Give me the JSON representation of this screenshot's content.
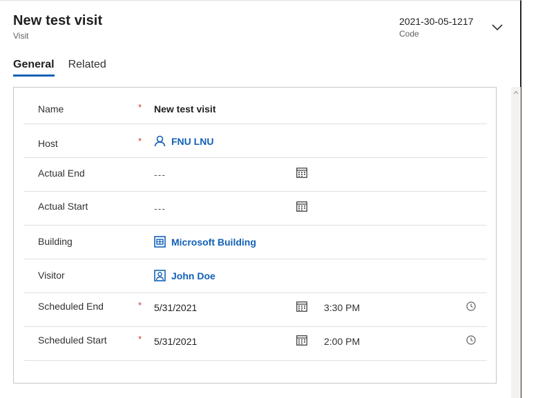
{
  "header": {
    "title": "New test visit",
    "entity": "Visit",
    "code_value": "2021-30-05-1217",
    "code_label": "Code"
  },
  "tabs": [
    {
      "label": "General",
      "active": true
    },
    {
      "label": "Related",
      "active": false
    }
  ],
  "fields": {
    "name": {
      "label": "Name",
      "required": "*",
      "value": "New test visit"
    },
    "host": {
      "label": "Host",
      "required": "*",
      "value": "FNU LNU",
      "icon": "person-icon"
    },
    "actual_end": {
      "label": "Actual End",
      "value": "---",
      "icon": "calendar-icon"
    },
    "actual_start": {
      "label": "Actual Start",
      "value": "---",
      "icon": "calendar-icon"
    },
    "building": {
      "label": "Building",
      "value": "Microsoft Building",
      "icon": "building-icon"
    },
    "visitor": {
      "label": "Visitor",
      "value": "John Doe",
      "icon": "contact-icon"
    },
    "scheduled_end": {
      "label": "Scheduled End",
      "required": "*",
      "date": "5/31/2021",
      "time": "3:30 PM"
    },
    "scheduled_start": {
      "label": "Scheduled Start",
      "required": "*",
      "date": "5/31/2021",
      "time": "2:00 PM"
    }
  },
  "colors": {
    "accent": "#1160b7",
    "required": "#d13438",
    "border": "#c8c6c4"
  }
}
